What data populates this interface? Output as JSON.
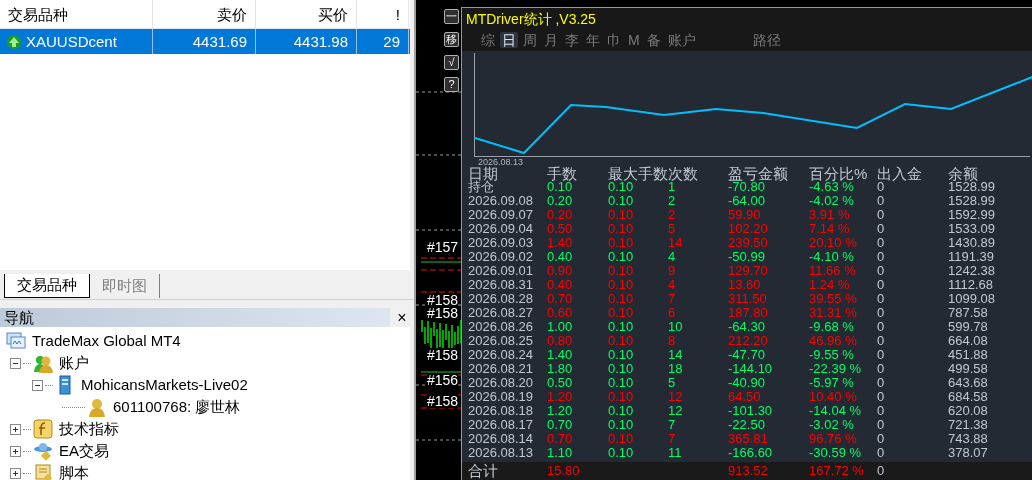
{
  "market_watch": {
    "columns": [
      "交易品种",
      "卖价",
      "买价",
      "!"
    ],
    "rows": [
      {
        "symbol": "XAUUSDcent",
        "bid": "4431.69",
        "ask": "4431.98",
        "spread": "29",
        "selected": true
      }
    ]
  },
  "left_tabs": [
    {
      "label": "交易品种",
      "selected": true
    },
    {
      "label": "即时图",
      "selected": false
    }
  ],
  "navigator": {
    "title": "导航",
    "close": "×",
    "tree": [
      {
        "label": "TradeMax Global MT4",
        "kind": "terminal",
        "children": [
          {
            "label": "账户",
            "kind": "accounts",
            "expanded": true,
            "children": [
              {
                "label": "MohicansMarkets-Live02",
                "kind": "server",
                "expanded": true,
                "children": [
                  {
                    "label": "601100768: 廖世林",
                    "kind": "user"
                  }
                ]
              }
            ]
          },
          {
            "label": "技术指标",
            "kind": "indicators",
            "expanded": false
          },
          {
            "label": "EA交易",
            "kind": "experts",
            "expanded": false
          },
          {
            "label": "脚本",
            "kind": "scripts",
            "expanded": false
          }
        ]
      }
    ]
  },
  "chart": {
    "side_buttons": [
      "一",
      "移",
      "√",
      "?"
    ],
    "order_labels": [
      "#157",
      "#158",
      "#158",
      "#158",
      "#156",
      "#158"
    ]
  },
  "stats": {
    "title": "MTDriver统计 ,V3.25",
    "period_tabs": [
      {
        "label": "综",
        "selected": false
      },
      {
        "label": "日",
        "selected": true
      },
      {
        "label": "周",
        "selected": false
      },
      {
        "label": "月",
        "selected": false
      },
      {
        "label": "李",
        "selected": false
      },
      {
        "label": "年",
        "selected": false
      },
      {
        "label": "巾",
        "selected": false
      },
      {
        "label": "M",
        "selected": false
      },
      {
        "label": "备",
        "selected": false
      },
      {
        "label": "账户",
        "selected": false
      },
      {
        "label": "路径",
        "selected": false
      }
    ],
    "curve_start": "2026.08.13",
    "columns": [
      "日期",
      "手数",
      "最大手数",
      "次数",
      "盈亏金额",
      "百分比%",
      "出入金",
      "余额"
    ],
    "rows": [
      {
        "date": "持仓",
        "lots": "0.10",
        "max_lots": "0.10",
        "count": "1",
        "pnl": "-70.80",
        "pct": "-4.63 %",
        "flow": "0",
        "balance": "1528.99",
        "color": "#00ff66"
      },
      {
        "date": "2026.09.08",
        "lots": "0.20",
        "max_lots": "0.10",
        "count": "2",
        "pnl": "-64.00",
        "pct": "-4.02 %",
        "flow": "0",
        "balance": "1528.99",
        "color": "#00ff66"
      },
      {
        "date": "2026.09.07",
        "lots": "0.20",
        "max_lots": "0.10",
        "count": "2",
        "pnl": "59.90",
        "pct": "3.91 %",
        "flow": "0",
        "balance": "1592.99",
        "color": "#ff0000"
      },
      {
        "date": "2026.09.04",
        "lots": "0.50",
        "max_lots": "0.10",
        "count": "5",
        "pnl": "102.20",
        "pct": "7.14 %",
        "flow": "0",
        "balance": "1533.09",
        "color": "#ff0000"
      },
      {
        "date": "2026.09.03",
        "lots": "1.40",
        "max_lots": "0.10",
        "count": "14",
        "pnl": "239.50",
        "pct": "20.10 %",
        "flow": "0",
        "balance": "1430.89",
        "color": "#ff0000"
      },
      {
        "date": "2026.09.02",
        "lots": "0.40",
        "max_lots": "0.10",
        "count": "4",
        "pnl": "-50.99",
        "pct": "-4.10 %",
        "flow": "0",
        "balance": "1191.39",
        "color": "#00ff66"
      },
      {
        "date": "2026.09.01",
        "lots": "0.90",
        "max_lots": "0.10",
        "count": "9",
        "pnl": "129.70",
        "pct": "11.66 %",
        "flow": "0",
        "balance": "1242.38",
        "color": "#ff0000"
      },
      {
        "date": "2026.08.31",
        "lots": "0.40",
        "max_lots": "0.10",
        "count": "4",
        "pnl": "13.60",
        "pct": "1.24 %",
        "flow": "0",
        "balance": "1112.68",
        "color": "#ff0000"
      },
      {
        "date": "2026.08.28",
        "lots": "0.70",
        "max_lots": "0.10",
        "count": "7",
        "pnl": "311.50",
        "pct": "39.55 %",
        "flow": "0",
        "balance": "1099.08",
        "color": "#ff0000"
      },
      {
        "date": "2026.08.27",
        "lots": "0.60",
        "max_lots": "0.10",
        "count": "6",
        "pnl": "187.80",
        "pct": "31.31 %",
        "flow": "0",
        "balance": "787.58",
        "color": "#ff0000"
      },
      {
        "date": "2026.08.26",
        "lots": "1.00",
        "max_lots": "0.10",
        "count": "10",
        "pnl": "-64.30",
        "pct": "-9.68 %",
        "flow": "0",
        "balance": "599.78",
        "color": "#00ff66"
      },
      {
        "date": "2026.08.25",
        "lots": "0.80",
        "max_lots": "0.10",
        "count": "8",
        "pnl": "212.20",
        "pct": "46.96 %",
        "flow": "0",
        "balance": "664.08",
        "color": "#ff0000"
      },
      {
        "date": "2026.08.24",
        "lots": "1.40",
        "max_lots": "0.10",
        "count": "14",
        "pnl": "-47.70",
        "pct": "-9.55 %",
        "flow": "0",
        "balance": "451.88",
        "color": "#00ff66"
      },
      {
        "date": "2026.08.21",
        "lots": "1.80",
        "max_lots": "0.10",
        "count": "18",
        "pnl": "-144.10",
        "pct": "-22.39 %",
        "flow": "0",
        "balance": "499.58",
        "color": "#00ff66"
      },
      {
        "date": "2026.08.20",
        "lots": "0.50",
        "max_lots": "0.10",
        "count": "5",
        "pnl": "-40.90",
        "pct": "-5.97 %",
        "flow": "0",
        "balance": "643.68",
        "color": "#00ff66"
      },
      {
        "date": "2026.08.19",
        "lots": "1.20",
        "max_lots": "0.10",
        "count": "12",
        "pnl": "64.50",
        "pct": "10.40 %",
        "flow": "0",
        "balance": "684.58",
        "color": "#ff0000"
      },
      {
        "date": "2026.08.18",
        "lots": "1.20",
        "max_lots": "0.10",
        "count": "12",
        "pnl": "-101.30",
        "pct": "-14.04 %",
        "flow": "0",
        "balance": "620.08",
        "color": "#00ff66"
      },
      {
        "date": "2026.08.17",
        "lots": "0.70",
        "max_lots": "0.10",
        "count": "7",
        "pnl": "-22.50",
        "pct": "-3.02 %",
        "flow": "0",
        "balance": "721.38",
        "color": "#00ff66"
      },
      {
        "date": "2026.08.14",
        "lots": "0.70",
        "max_lots": "0.10",
        "count": "7",
        "pnl": "365.81",
        "pct": "96.76 %",
        "flow": "0",
        "balance": "743.88",
        "color": "#ff0000"
      },
      {
        "date": "2026.08.13",
        "lots": "1.10",
        "max_lots": "0.10",
        "count": "11",
        "pnl": "-166.60",
        "pct": "-30.59 %",
        "flow": "0",
        "balance": "378.07",
        "color": "#00ff66"
      }
    ],
    "total": {
      "date": "合计",
      "lots": "15.80",
      "pnl": "913.52",
      "pct": "167.72 %",
      "flow": "0",
      "color": "#ff0000"
    }
  }
}
